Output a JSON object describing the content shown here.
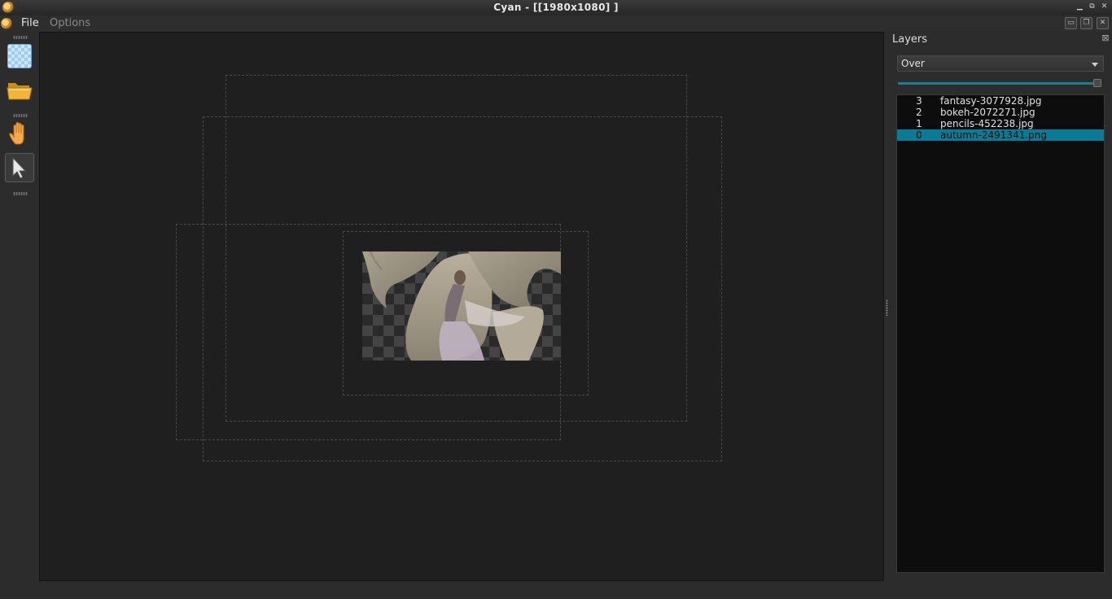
{
  "window": {
    "title": "Cyan - [[1980x1080] ]"
  },
  "menu": {
    "items": [
      "File",
      "Options"
    ]
  },
  "toolbar": {
    "tools": [
      "new-layer",
      "open-folder",
      "pan-hand",
      "select-pointer"
    ],
    "active_tool": "select-pointer"
  },
  "layers_panel": {
    "title": "Layers",
    "blend_mode": "Over",
    "opacity": 1.0,
    "layers": [
      {
        "index": "3",
        "name": "fantasy-3077928.jpg",
        "selected": false
      },
      {
        "index": "2",
        "name": "bokeh-2072271.jpg",
        "selected": false
      },
      {
        "index": "1",
        "name": "pencils-452238.jpg",
        "selected": false
      },
      {
        "index": "0",
        "name": "autumn-2491341.png",
        "selected": true
      }
    ]
  },
  "colors": {
    "accent": "#0a7a96",
    "slider": "#1d7f96",
    "viewport_bg": "#1f1f1f",
    "list_bg": "#0d0d0d"
  }
}
